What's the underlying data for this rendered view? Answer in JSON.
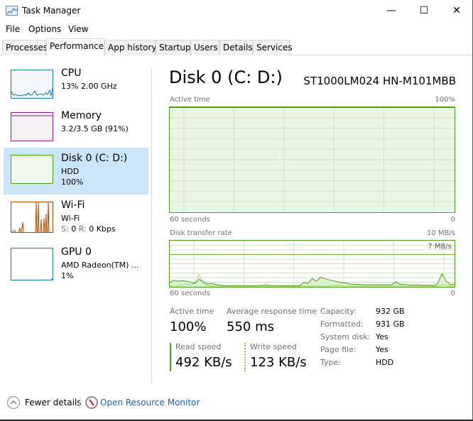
{
  "window": {
    "title": "Task Manager",
    "controls": {
      "minimize": "—",
      "maximize": "☐",
      "close": "✕"
    }
  },
  "menu": [
    "File",
    "Options",
    "View"
  ],
  "tabs": [
    {
      "label": "Processes",
      "active": false
    },
    {
      "label": "Performance",
      "active": true
    },
    {
      "label": "App history",
      "active": false
    },
    {
      "label": "Startup",
      "active": false
    },
    {
      "label": "Users",
      "active": false
    },
    {
      "label": "Details",
      "active": false
    },
    {
      "label": "Services",
      "active": false
    }
  ],
  "sidebar": {
    "items": [
      {
        "title": "CPU",
        "line1": "13% 2.00 GHz",
        "line2": "",
        "color": "#1a7a9a",
        "fill": "#f1f6fa",
        "active": false
      },
      {
        "title": "Memory",
        "line1": "3.2/3.5 GB (91%)",
        "line2": "",
        "color": "#8b1f8f",
        "fill": "#f4f0f4",
        "active": false
      },
      {
        "title": "Disk 0 (C: D:)",
        "line1": "HDD",
        "line2": "100%",
        "color": "#4d9a1e",
        "fill": "#eff7ea",
        "active": true
      },
      {
        "title": "Wi-Fi",
        "line1": "Wi-Fi",
        "line2_prefix_s": "S:",
        "line2_s": "0",
        "line2_prefix_r": "R:",
        "line2_r": "0 Kbps",
        "color": "#a74f01",
        "fill": "#ffffff",
        "active": false
      },
      {
        "title": "GPU 0",
        "line1": "AMD Radeon(TM) ...",
        "line2": "1%",
        "color": "#1a7a9a",
        "fill": "#ffffff",
        "active": false
      }
    ]
  },
  "main": {
    "title": "Disk 0 (C: D:)",
    "model": "ST1000LM024 HN-M101MBB",
    "active_time_graph": {
      "label": "Active time",
      "max_label": "100%",
      "time_label": "60 seconds",
      "min_label": "0",
      "value_percent": 100
    },
    "transfer_graph": {
      "label": "Disk transfer rate",
      "max_label": "10 MB/s",
      "ref_label": "7 MB/s",
      "time_label": "60 seconds",
      "min_label": "0",
      "max_mbps": 10,
      "ref_mbps": 7,
      "read_mbps": [
        0.8,
        1.3,
        1.1,
        1.2,
        1.1,
        0.9,
        0.6,
        1.5,
        1.0,
        0.5,
        0.6,
        0.4,
        0.2,
        0.1,
        0.1,
        0.1,
        0.1,
        0.1,
        0.1,
        0.1,
        0.1,
        0.1,
        0.1,
        0.1,
        0.1,
        0.1,
        0.1,
        0.1,
        0.1,
        0.1,
        0.1,
        0.1,
        0.8,
        0.6,
        1.7,
        1.1,
        2.0,
        1.7,
        1.4,
        1.2,
        1.0,
        0.8,
        0.7,
        0.5,
        0.4,
        0.4,
        0.3,
        0.3,
        0.3,
        0.3,
        0.3,
        0.3,
        0.3,
        0.3,
        0.9,
        0.4,
        0.4,
        0.3,
        0.2,
        0.3,
        0.2,
        0.2,
        0.2,
        0.1,
        0.6,
        2.8,
        1.1,
        0.4,
        0.4
      ],
      "write_mbps": [
        0,
        0,
        0,
        0.2,
        0.4,
        0.2,
        0.8,
        2.6,
        0.6,
        0.2,
        0,
        0,
        0,
        0,
        0,
        0,
        0,
        0,
        0,
        0,
        0,
        0,
        0.2,
        0.5,
        0.1,
        0,
        0,
        0,
        0,
        0,
        0,
        0,
        0,
        0,
        0,
        0,
        0,
        0,
        0,
        0.1,
        0.2,
        0.1,
        0,
        0,
        0,
        0,
        0,
        0,
        0,
        0,
        0,
        0,
        0,
        0,
        0,
        0,
        0,
        0,
        0,
        0,
        0,
        0,
        0,
        0,
        0,
        0.3,
        0.2,
        0,
        0
      ]
    },
    "stats": {
      "active_time": {
        "label": "Active time",
        "value": "100%"
      },
      "avg_response": {
        "label": "Average response time",
        "value": "550 ms"
      },
      "read_speed": {
        "label": "Read speed",
        "value": "492 KB/s"
      },
      "write_speed": {
        "label": "Write speed",
        "value": "123 KB/s"
      }
    },
    "properties": [
      {
        "label": "Capacity:",
        "value": "932 GB"
      },
      {
        "label": "Formatted:",
        "value": "931 GB"
      },
      {
        "label": "System disk:",
        "value": "Yes"
      },
      {
        "label": "Page file:",
        "value": "Yes"
      },
      {
        "label": "Type:",
        "value": "HDD"
      }
    ]
  },
  "footer": {
    "fewer_details": "Fewer details",
    "resource_monitor": "Open Resource Monitor"
  },
  "colors": {
    "disk_accent": "#4d9a1e",
    "disk_fill": "#eff7ea",
    "selection": "#cce4f7",
    "link": "#1f62a6"
  }
}
